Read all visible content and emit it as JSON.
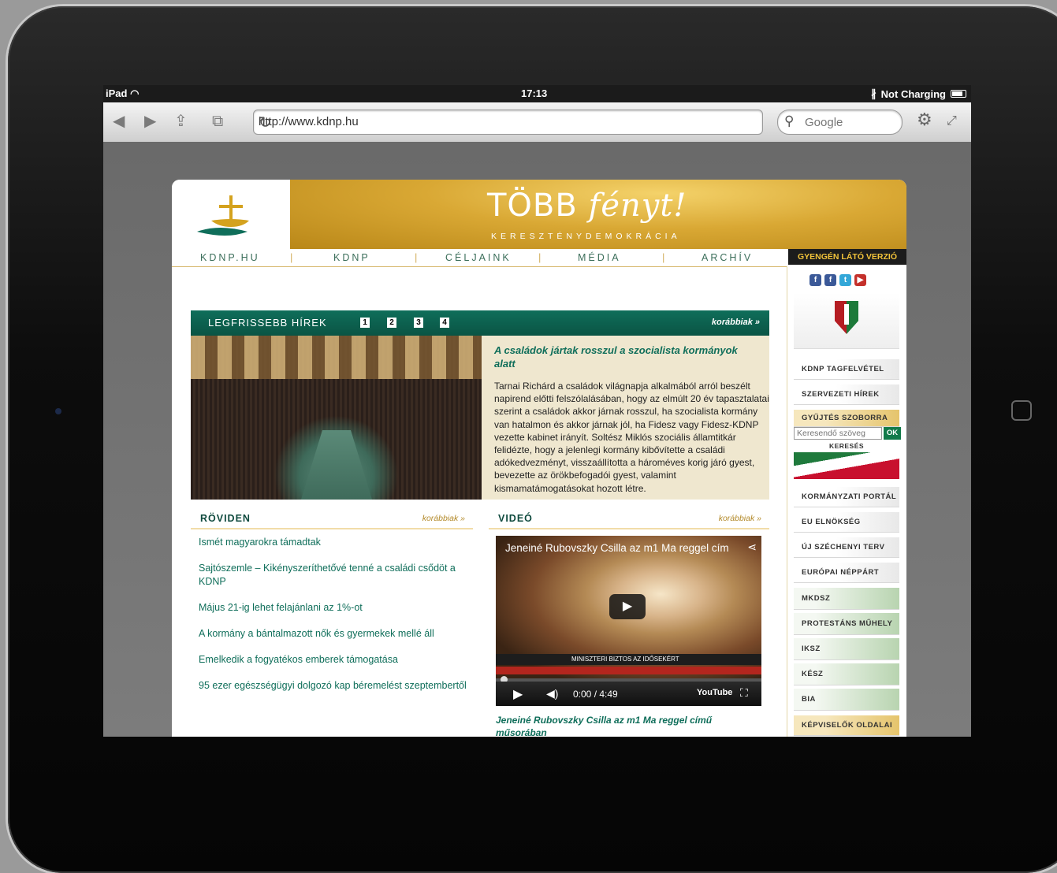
{
  "status": {
    "device": "iPad",
    "time": "17:13",
    "charging": "Not Charging"
  },
  "browser": {
    "url": "http://www.kdnp.hu",
    "search_placeholder": "Google"
  },
  "site": {
    "banner_title_1": "TÖBB ",
    "banner_title_2": "fényt!",
    "banner_sub": "KERESZTÉNYDEMOKRÁCIA",
    "nav": [
      "KDNP.HU",
      "KDNP",
      "CÉLJAINK",
      "MÉDIA",
      "ARCHÍV"
    ],
    "weak_sight": "GYENGÉN LÁTÓ VERZIÓ"
  },
  "latest": {
    "title": "LEGFRISSEBB HÍREK",
    "pages": [
      "1",
      "2",
      "3",
      "4"
    ],
    "more": "korábbiak »",
    "headline": "A családok jártak rosszul a szocialista kormányok alatt",
    "body": "Tarnai Richárd a családok világnapja alkalmából arról beszélt napirend előtti felszólalásában, hogy az elmúlt 20 év tapasztalatai szerint a családok akkor járnak rosszul, ha szocialista kormány van hatalmon és akkor járnak jól, ha Fidesz vagy Fidesz-KDNP vezette kabinet irányít. Soltész Miklós szociális államtitkár felidézte, hogy a jelenlegi kormány kibővítette a családi adókedvezményt, visszaállította a hároméves korig járó gyest, bevezette az örökbefogadói gyest, valamint kismamatámogatásokat hozott létre."
  },
  "roviden": {
    "title": "RÖVIDEN",
    "more": "korábbiak »",
    "items": [
      "Ismét magyarokra támadtak",
      "Sajtószemle – Kikényszeríthetővé tenné a családi csődöt a KDNP",
      "Május 21-ig lehet felajánlani az 1%-ot",
      "A kormány a bántalmazott nők és gyermekek mellé áll",
      "Emelkedik a fogyatékos emberek támogatása",
      "95 ezer egészségügyi dolgozó kap béremelést szeptembertől"
    ]
  },
  "video": {
    "title": "VIDEÓ",
    "more": "korábbiak »",
    "player_title": "Jeneiné Rubovszky Csilla az m1 Ma reggel cím",
    "ticker": "MINISZTERI BIZTOS AZ IDŐSEKÉRT",
    "time": "0:00 / 4:49",
    "brand": "YouTube",
    "caption": "Jeneiné Rubovszky Csilla az m1 Ma reggel című műsorában"
  },
  "sidebar": {
    "social": [
      "f",
      "f",
      "t",
      "▶"
    ],
    "links_top": [
      "KDNP TAGFELVÉTEL",
      "SZERVEZETI HÍREK"
    ],
    "collect": "GYŰJTÉS SZOBORRA",
    "search_placeholder": "Keresendő szöveg",
    "ok": "OK",
    "search_label": "KERESÉS",
    "links_mid": [
      "KORMÁNYZATI PORTÁL",
      "EU ELNÖKSÉG",
      "ÚJ SZÉCHENYI TERV",
      "EURÓPAI NÉPPÁRT"
    ],
    "links_green": [
      "MKDSZ",
      "PROTESTÁNS MŰHELY",
      "IKSZ",
      "KÉSZ",
      "BIA"
    ],
    "representatives": "KÉPVISELŐK OLDALAI"
  }
}
